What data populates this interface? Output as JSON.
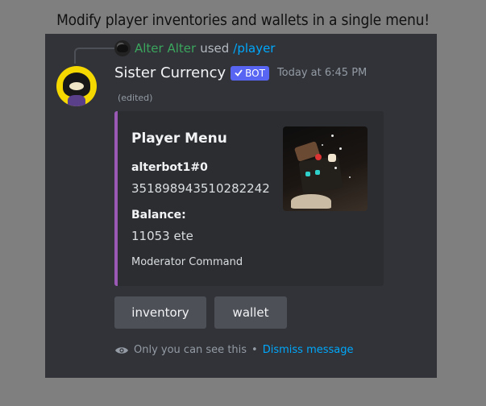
{
  "caption": "Modify player inventories and wallets in a single menu!",
  "reply": {
    "user": "Alter Alter",
    "used": "used",
    "command": "/player"
  },
  "message": {
    "username": "Sister Currency",
    "bot_tag": "BOT",
    "timestamp": "Today at 6:45 PM",
    "edited": "(edited)"
  },
  "embed": {
    "accent_color": "#9b59b6",
    "title": "Player Menu",
    "fields": [
      {
        "name": "alterbot1#0",
        "value": "351898943510282242"
      },
      {
        "name": "Balance:",
        "value": "11053 ete"
      }
    ],
    "footer": "Moderator Command"
  },
  "buttons": [
    {
      "label": "inventory"
    },
    {
      "label": "wallet"
    }
  ],
  "ephemeral": {
    "notice": "Only you can see this",
    "separator": "•",
    "dismiss": "Dismiss message"
  },
  "icons": {
    "verified": "check-icon",
    "visibility": "eye-icon"
  }
}
